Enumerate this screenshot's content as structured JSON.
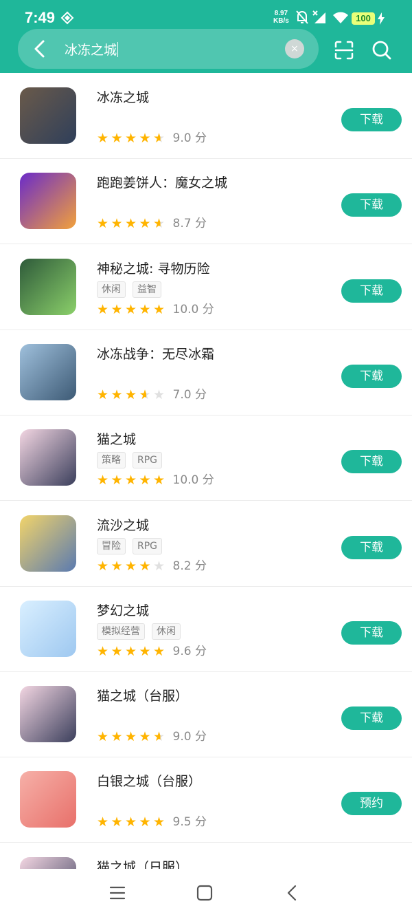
{
  "status_bar": {
    "time": "7:49",
    "net_speed_value": "8.97",
    "net_speed_unit": "KB/s",
    "battery": "100"
  },
  "search": {
    "query": "冰冻之城",
    "clear_symbol": "×"
  },
  "results": [
    {
      "title": "冰冻之城",
      "tags": [],
      "rating": 4.5,
      "score": "9.0 分",
      "button": "下载",
      "icon_colors": [
        "#6a5a4a",
        "#2f3f5a"
      ]
    },
    {
      "title": "跑跑姜饼人：魔女之城",
      "tags": [],
      "rating": 4.5,
      "score": "8.7 分",
      "button": "下载",
      "icon_colors": [
        "#6a2bc9",
        "#f2a13b"
      ]
    },
    {
      "title": "神秘之城: 寻物历险",
      "tags": [
        "休闲",
        "益智"
      ],
      "rating": 5,
      "score": "10.0 分",
      "button": "下载",
      "icon_colors": [
        "#2e5a3a",
        "#8bd06a"
      ]
    },
    {
      "title": "冰冻战争：无尽冰霜",
      "tags": [],
      "rating": 3.5,
      "score": "7.0 分",
      "button": "下载",
      "icon_colors": [
        "#9fc0dc",
        "#3d5a75"
      ]
    },
    {
      "title": "猫之城",
      "tags": [
        "策略",
        "RPG"
      ],
      "rating": 5,
      "score": "10.0 分",
      "button": "下载",
      "icon_colors": [
        "#f3d6e2",
        "#3b3f5c"
      ]
    },
    {
      "title": "流沙之城",
      "tags": [
        "冒险",
        "RPG"
      ],
      "rating": 4,
      "score": "8.2 分",
      "button": "下载",
      "icon_colors": [
        "#f2d46a",
        "#5a7ab0"
      ]
    },
    {
      "title": "梦幻之城",
      "tags": [
        "模拟经营",
        "休闲"
      ],
      "rating": 5,
      "score": "9.6 分",
      "button": "下载",
      "icon_colors": [
        "#d9efff",
        "#9ec8f0"
      ]
    },
    {
      "title": "猫之城（台服）",
      "tags": [],
      "rating": 4.5,
      "score": "9.0 分",
      "button": "下载",
      "icon_colors": [
        "#f3d6e2",
        "#3b3f5c"
      ]
    },
    {
      "title": "白银之城（台服）",
      "tags": [],
      "rating": 5,
      "score": "9.5 分",
      "button": "预约",
      "icon_colors": [
        "#f6b0a8",
        "#e8706a"
      ]
    },
    {
      "title": "猫之城（日服）",
      "tags": [],
      "rating": 0,
      "score": "",
      "button": "",
      "icon_colors": [
        "#f3d6e2",
        "#3b3f5c"
      ]
    }
  ],
  "colors": {
    "accent": "#1fb79a",
    "star": "#ffb400",
    "star_empty": "#e0e0e0"
  }
}
